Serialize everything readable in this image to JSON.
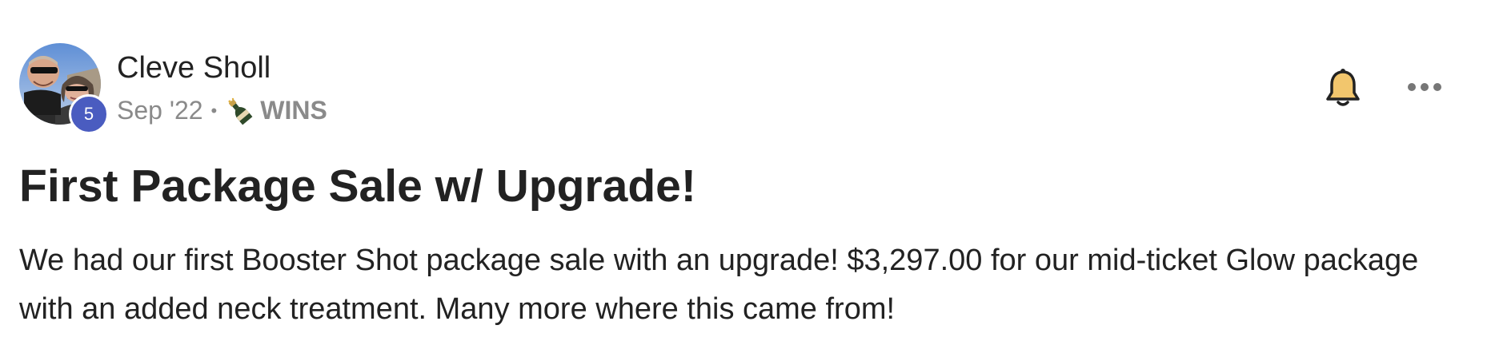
{
  "post": {
    "author": {
      "name": "Cleve Sholl",
      "level": "5",
      "avatar_icon": "user-photo-avatar"
    },
    "meta": {
      "date": "Sep '22",
      "separator": "•",
      "category_icon": "champagne-bottle-icon",
      "category": "WINS"
    },
    "actions": {
      "bell_icon": "bell-icon",
      "more_icon": "more-horizontal-icon"
    },
    "title": "First Package Sale w/ Upgrade!",
    "body": "We had our first Booster Shot package sale with an upgrade! $3,297.00 for our mid-ticket Glow package with an added neck treatment. Many more where this came from!"
  },
  "colors": {
    "level_badge": "#4a5cc0",
    "bell_fill": "#f2c66d",
    "muted_text": "#8a8a8a",
    "text": "#222222"
  }
}
